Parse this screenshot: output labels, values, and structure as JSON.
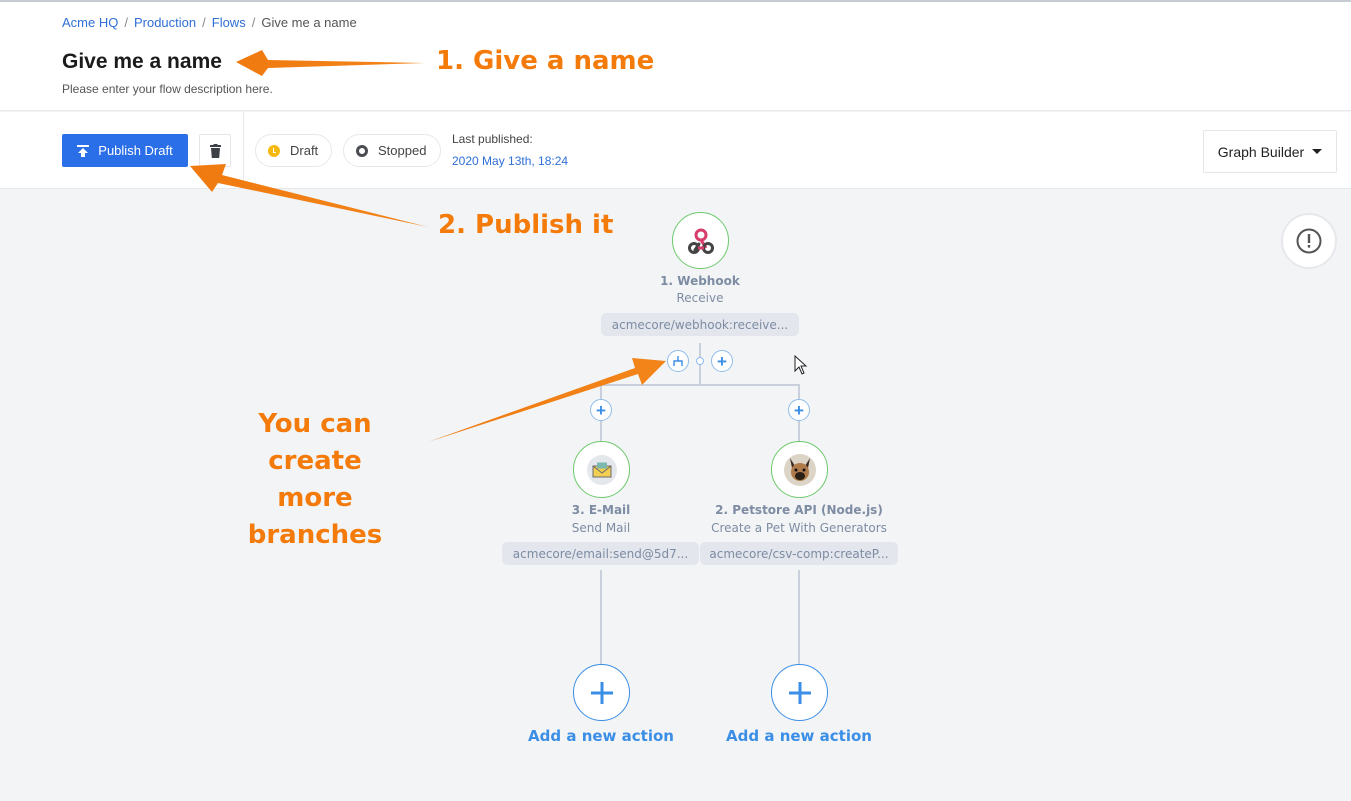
{
  "breadcrumb": [
    "Acme HQ",
    "Production",
    "Flows",
    "Give me a name"
  ],
  "header": {
    "title": "Give me a name",
    "description": "Please enter your flow description here."
  },
  "toolbar": {
    "publish_label": "Publish Draft",
    "draft_label": "Draft",
    "stopped_label": "Stopped",
    "last_published_label": "Last published:",
    "last_published_date": "2020 May 13th, 18:24",
    "view_select": "Graph Builder"
  },
  "flow": {
    "trigger": {
      "title": "1. Webhook",
      "subtitle": "Receive",
      "tag": "acmecore/webhook:receive..."
    },
    "branches": [
      {
        "title": "3. E-Mail",
        "subtitle": "Send Mail",
        "tag": "acmecore/email:send@5d7...",
        "icon": "envelope-icon",
        "add_label": "Add a new action"
      },
      {
        "title": "2. Petstore API (Node.js)",
        "subtitle": "Create a Pet With Generators",
        "tag": "acmecore/csv-comp:createP...",
        "icon": "dog-avatar-icon",
        "add_label": "Add a new action"
      }
    ]
  },
  "annotations": {
    "step1": "1. Give a name",
    "step2": "2. Publish it",
    "branches_line1": "You can create",
    "branches_line2": "more branches"
  },
  "colors": {
    "accent": "#2b6fe8",
    "link": "#2f6fd6",
    "annotation": "#f47a0a",
    "node_border": "#6cca6c",
    "add_blue": "#3a8ee6",
    "draft": "#f5b90f"
  }
}
